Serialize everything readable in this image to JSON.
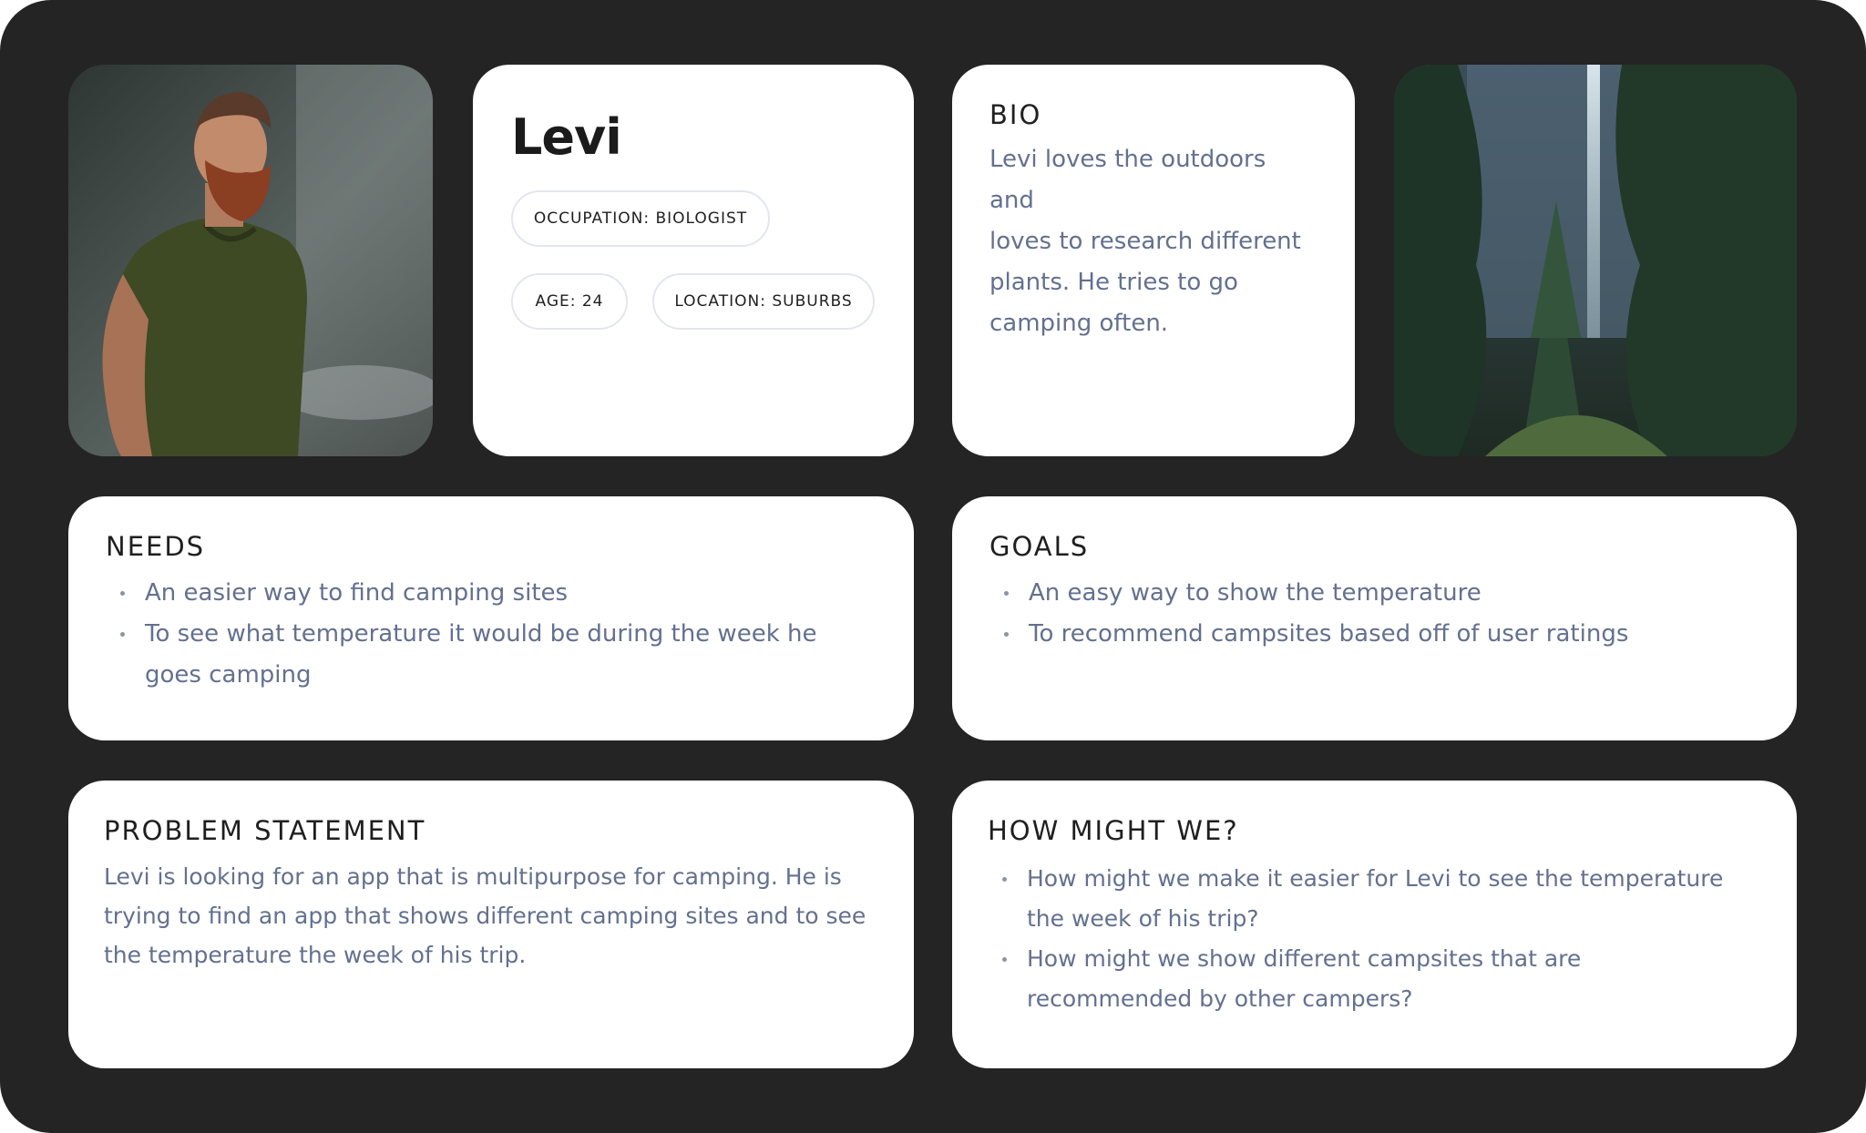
{
  "persona": {
    "name": "Levi",
    "tags": {
      "occupation": "OCCUPATION: BIOLOGIST",
      "age": "AGE: 24",
      "location": "LOCATION: SUBURBS"
    }
  },
  "bio": {
    "heading": "BIO",
    "lines": [
      "Levi loves the outdoors and",
      "loves to research different",
      "plants. He tries to go",
      "camping often."
    ]
  },
  "needs": {
    "heading": "NEEDS",
    "items": [
      "An easier way to find camping sites",
      "To see what temperature it would be during the week he goes camping"
    ]
  },
  "goals": {
    "heading": "GOALS",
    "items": [
      "An easy way to show the temperature",
      "To recommend campsites based off of user ratings"
    ]
  },
  "problem": {
    "heading": "PROBLEM STATEMENT",
    "lines": [
      "Levi is looking for an app that is multipurpose for camping. He is",
      "trying to find an app that shows different camping sites and to see",
      "the temperature the week of his trip."
    ]
  },
  "hmw": {
    "heading": "HOW MIGHT WE?",
    "items": [
      "How might we make it easier for Levi to see the temperature the week of his trip?",
      "How might we show different campsites that are recommended by other campers?"
    ]
  },
  "images": {
    "portrait_icon": "portrait-photo",
    "forest_icon": "forest-waterfall-photo"
  },
  "colors": {
    "background": "#242424",
    "card": "#ffffff",
    "body_text": "#63708f",
    "heading_text": "#1f1f1f"
  }
}
